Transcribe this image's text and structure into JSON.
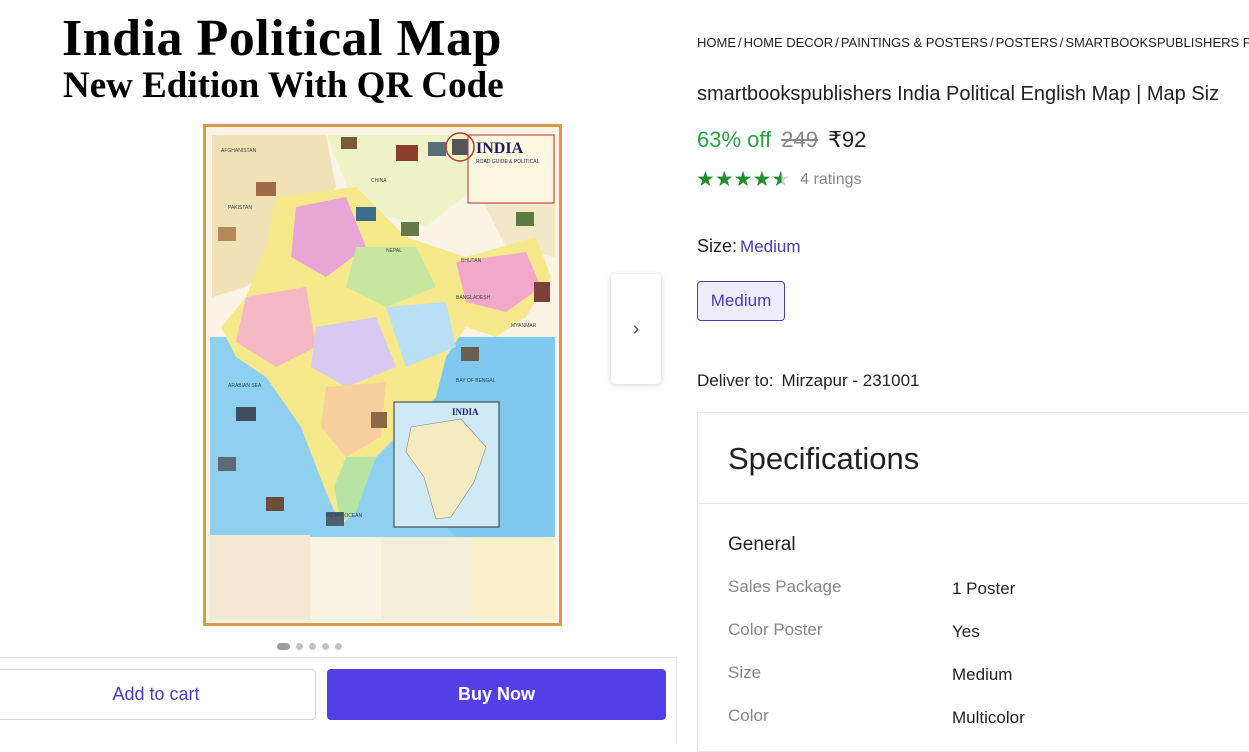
{
  "hero": {
    "title": "India Political Map",
    "subtitle": "New Edition With QR Code"
  },
  "poster": {
    "map_heading": "INDIA",
    "map_subheading": "ROAD GUIDE & POLITICAL",
    "inset_heading": "INDIA",
    "sea_label": "BAY OF BENGAL",
    "ocean_label": "INDIAN OCEAN",
    "arabian_label": "ARABIAN SEA",
    "china_label": "CHINA",
    "pakistan_label": "PAKISTAN",
    "afghanistan_label": "AFGHANISTAN",
    "nepal_label": "NEPAL",
    "bhutan_label": "BHUTAN",
    "bangladesh_label": "BANGLADESH",
    "myanmar_label": "MYANMAR",
    "colors": {
      "frame": "#d59a4a",
      "sea": "#7fc8ee",
      "paper": "#fbf4e6"
    }
  },
  "carousel": {
    "next_icon": "chevron-right-icon",
    "slide_count": 5,
    "active_index": 0
  },
  "actions": {
    "add_to_cart": "Add to cart",
    "buy_now": "Buy Now"
  },
  "breadcrumb": [
    "HOME",
    "HOME DECOR",
    "PAINTINGS & POSTERS",
    "POSTERS",
    "SMARTBOOKSPUBLISHERS POS"
  ],
  "product": {
    "title": "smartbookspublishers India Political English Map | Map Siz",
    "discount": "63% off",
    "mrp": "249",
    "price": "₹92",
    "rating": 4.5,
    "rating_count": "4 ratings"
  },
  "size": {
    "label": "Size:",
    "selected": "Medium",
    "options": [
      "Medium"
    ]
  },
  "delivery": {
    "label": "Deliver to:",
    "location": "Mirzapur - 231001"
  },
  "specifications": {
    "title": "Specifications",
    "section": "General",
    "rows": [
      {
        "key": "Sales Package",
        "value": "1 Poster"
      },
      {
        "key": "Color Poster",
        "value": "Yes"
      },
      {
        "key": "Size",
        "value": "Medium"
      },
      {
        "key": "Color",
        "value": "Multicolor"
      }
    ]
  },
  "colors": {
    "accent": "#5240e6",
    "discount_green": "#26a541",
    "star_green": "#1f8f2c",
    "link_purple": "#4a3bb5"
  }
}
